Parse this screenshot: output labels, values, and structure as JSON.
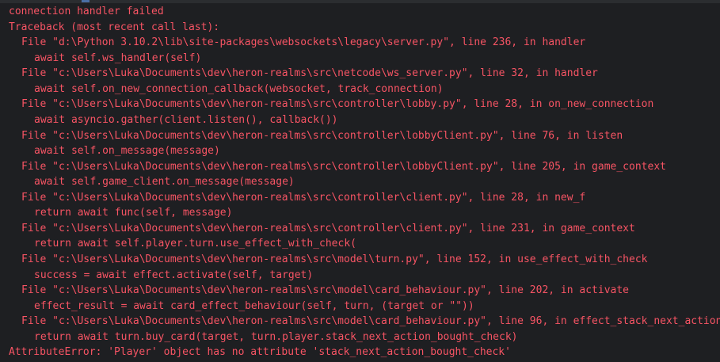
{
  "terminal": {
    "color": "#f75464",
    "background": "#1e1f22",
    "lines": [
      {
        "indent": 0,
        "text": "connection handler failed"
      },
      {
        "indent": 0,
        "text": "Traceback (most recent call last):"
      },
      {
        "indent": 1,
        "text": "File \"d:\\Python 3.10.2\\lib\\site-packages\\websockets\\legacy\\server.py\", line 236, in handler"
      },
      {
        "indent": 2,
        "text": "await self.ws_handler(self)"
      },
      {
        "indent": 1,
        "text": "File \"c:\\Users\\Luka\\Documents\\dev\\heron-realms\\src\\netcode\\ws_server.py\", line 32, in handler"
      },
      {
        "indent": 2,
        "text": "await self.on_new_connection_callback(websocket, track_connection)"
      },
      {
        "indent": 1,
        "text": "File \"c:\\Users\\Luka\\Documents\\dev\\heron-realms\\src\\controller\\lobby.py\", line 28, in on_new_connection"
      },
      {
        "indent": 2,
        "text": "await asyncio.gather(client.listen(), callback())"
      },
      {
        "indent": 1,
        "text": "File \"c:\\Users\\Luka\\Documents\\dev\\heron-realms\\src\\controller\\lobbyClient.py\", line 76, in listen"
      },
      {
        "indent": 2,
        "text": "await self.on_message(message)"
      },
      {
        "indent": 1,
        "text": "File \"c:\\Users\\Luka\\Documents\\dev\\heron-realms\\src\\controller\\lobbyClient.py\", line 205, in game_context"
      },
      {
        "indent": 2,
        "text": "await self.game_client.on_message(message)"
      },
      {
        "indent": 1,
        "text": "File \"c:\\Users\\Luka\\Documents\\dev\\heron-realms\\src\\controller\\client.py\", line 28, in new_f"
      },
      {
        "indent": 2,
        "text": "return await func(self, message)"
      },
      {
        "indent": 1,
        "text": "File \"c:\\Users\\Luka\\Documents\\dev\\heron-realms\\src\\controller\\client.py\", line 231, in game_context"
      },
      {
        "indent": 2,
        "text": "return await self.player.turn.use_effect_with_check("
      },
      {
        "indent": 1,
        "text": "File \"c:\\Users\\Luka\\Documents\\dev\\heron-realms\\src\\model\\turn.py\", line 152, in use_effect_with_check"
      },
      {
        "indent": 2,
        "text": "success = await effect.activate(self, target)"
      },
      {
        "indent": 1,
        "text": "File \"c:\\Users\\Luka\\Documents\\dev\\heron-realms\\src\\model\\card_behaviour.py\", line 202, in activate"
      },
      {
        "indent": 2,
        "text": "effect_result = await card_effect_behaviour(self, turn, (target or \"\"))"
      },
      {
        "indent": 1,
        "text": "File \"c:\\Users\\Luka\\Documents\\dev\\heron-realms\\src\\model\\card_behaviour.py\", line 96, in effect_stack_next_action"
      },
      {
        "indent": 2,
        "text": "return await turn.buy_card(target, turn.player.stack_next_action_bought_check)"
      },
      {
        "indent": 0,
        "text": "AttributeError: 'Player' object has no attribute 'stack_next_action_bought_check'"
      }
    ]
  }
}
